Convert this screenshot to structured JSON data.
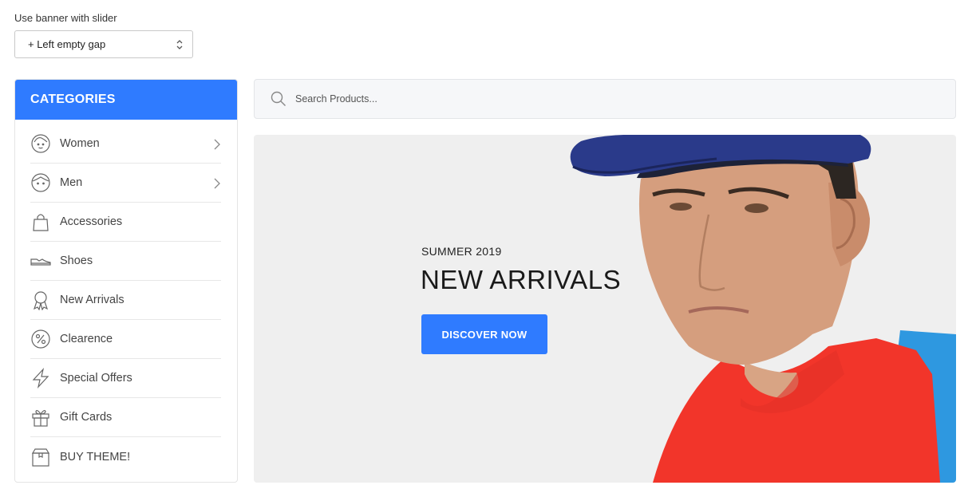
{
  "control": {
    "label": "Use banner with slider",
    "selected": "+ Left empty gap"
  },
  "categories": {
    "title": "CATEGORIES",
    "items": [
      {
        "label": "Women",
        "icon": "woman-face-icon",
        "has_submenu": true
      },
      {
        "label": "Men",
        "icon": "man-face-icon",
        "has_submenu": true
      },
      {
        "label": "Accessories",
        "icon": "bag-icon",
        "has_submenu": false
      },
      {
        "label": "Shoes",
        "icon": "shoe-icon",
        "has_submenu": false
      },
      {
        "label": "New Arrivals",
        "icon": "award-ribbon-icon",
        "has_submenu": false
      },
      {
        "label": "Clearence",
        "icon": "percent-icon",
        "has_submenu": false
      },
      {
        "label": "Special Offers",
        "icon": "lightning-icon",
        "has_submenu": false
      },
      {
        "label": "Gift Cards",
        "icon": "gift-icon",
        "has_submenu": false
      },
      {
        "label": "BUY THEME!",
        "icon": "box-icon",
        "has_submenu": false
      }
    ]
  },
  "search": {
    "placeholder": "Search Products..."
  },
  "banner": {
    "subtitle": "SUMMER 2019",
    "title": "NEW ARRIVALS",
    "button": "DISCOVER NOW"
  },
  "colors": {
    "accent": "#2f7bff",
    "banner_bg": "#efefef",
    "shirt": "#f2352a",
    "cap": "#2a3a8a"
  }
}
